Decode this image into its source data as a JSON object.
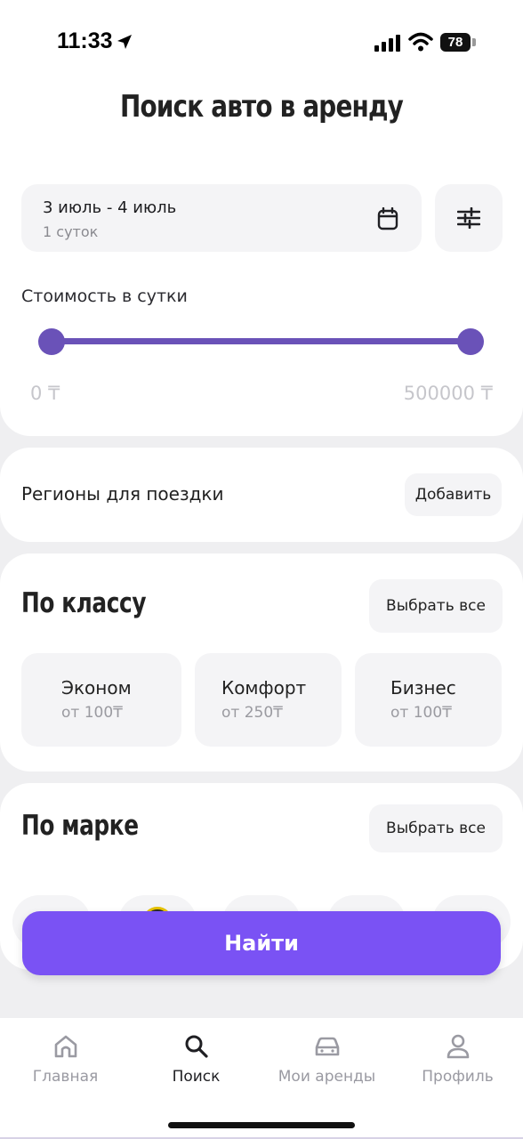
{
  "status_bar": {
    "time": "11:33",
    "battery": "78"
  },
  "header": {
    "title": "Поиск авто в аренду"
  },
  "dates": {
    "range": "3 июль - 4 июль",
    "duration": "1 суток"
  },
  "price": {
    "label": "Стоимость в сутки",
    "min": "0 ₸",
    "max": "500000 ₸",
    "range_fraction": [
      0,
      1
    ]
  },
  "regions": {
    "label": "Регионы для поездки",
    "add_label": "Добавить"
  },
  "by_class": {
    "title": "По классу",
    "select_all": "Выбрать все",
    "items": [
      {
        "name": "Эконом",
        "price": "от 100₸"
      },
      {
        "name": "Комфорт",
        "price": "от 250₸"
      },
      {
        "name": "Бизнес",
        "price": "от 100₸"
      }
    ]
  },
  "by_brand": {
    "title": "По марке",
    "select_all": "Выбрать все"
  },
  "find_button": "Найти",
  "tabs": [
    {
      "label": "Главная",
      "icon": "home-icon"
    },
    {
      "label": "Поиск",
      "icon": "search-icon"
    },
    {
      "label": "Мои аренды",
      "icon": "car-icon"
    },
    {
      "label": "Профиль",
      "icon": "profile-icon"
    }
  ],
  "colors": {
    "accent": "#7a52f4",
    "slider": "#6a52b8"
  }
}
